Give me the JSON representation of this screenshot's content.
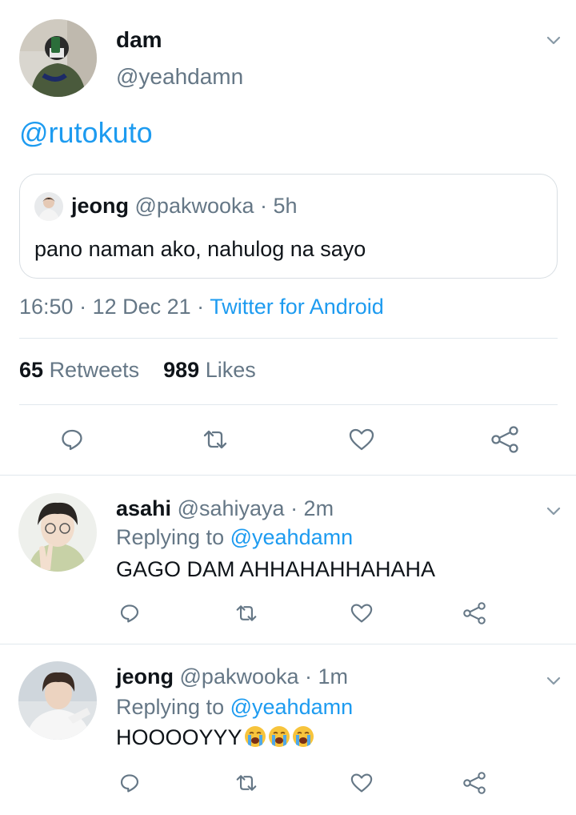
{
  "main_tweet": {
    "author_name": "dam",
    "author_handle": "@yeahdamn",
    "text": "@rutokuto",
    "quoted": {
      "author_name": "jeong",
      "author_handle": "@pakwooka",
      "time_ago": "· 5h",
      "text": "pano naman ako, nahulog na sayo"
    },
    "time": "16:50",
    "date": "· 12 Dec 21 ·",
    "source": "Twitter for Android",
    "retweets_count": "65",
    "retweets_label": "Retweets",
    "likes_count": "989",
    "likes_label": "Likes"
  },
  "replies": [
    {
      "author_name": "asahi",
      "author_handle": "@sahiyaya",
      "time_ago": "· 2m",
      "replying_label": "Replying to",
      "replying_handle": "@yeahdamn",
      "text": "GAGO DAM AHHAHAHHAHAHA"
    },
    {
      "author_name": "jeong",
      "author_handle": "@pakwooka",
      "time_ago": "· 1m",
      "replying_label": "Replying to",
      "replying_handle": "@yeahdamn",
      "text": "HOOOOYYY",
      "emojis": [
        "loudly-crying-face",
        "loudly-crying-face",
        "loudly-crying-face"
      ]
    }
  ],
  "icons": {
    "reply": "comment-icon",
    "retweet": "retweet-icon",
    "like": "heart-icon",
    "share": "share-icon",
    "menu": "chevron-down-icon"
  },
  "colors": {
    "link": "#1d9bf0",
    "muted": "#657786",
    "text": "#0f1419",
    "divider": "#e1e8ed"
  }
}
